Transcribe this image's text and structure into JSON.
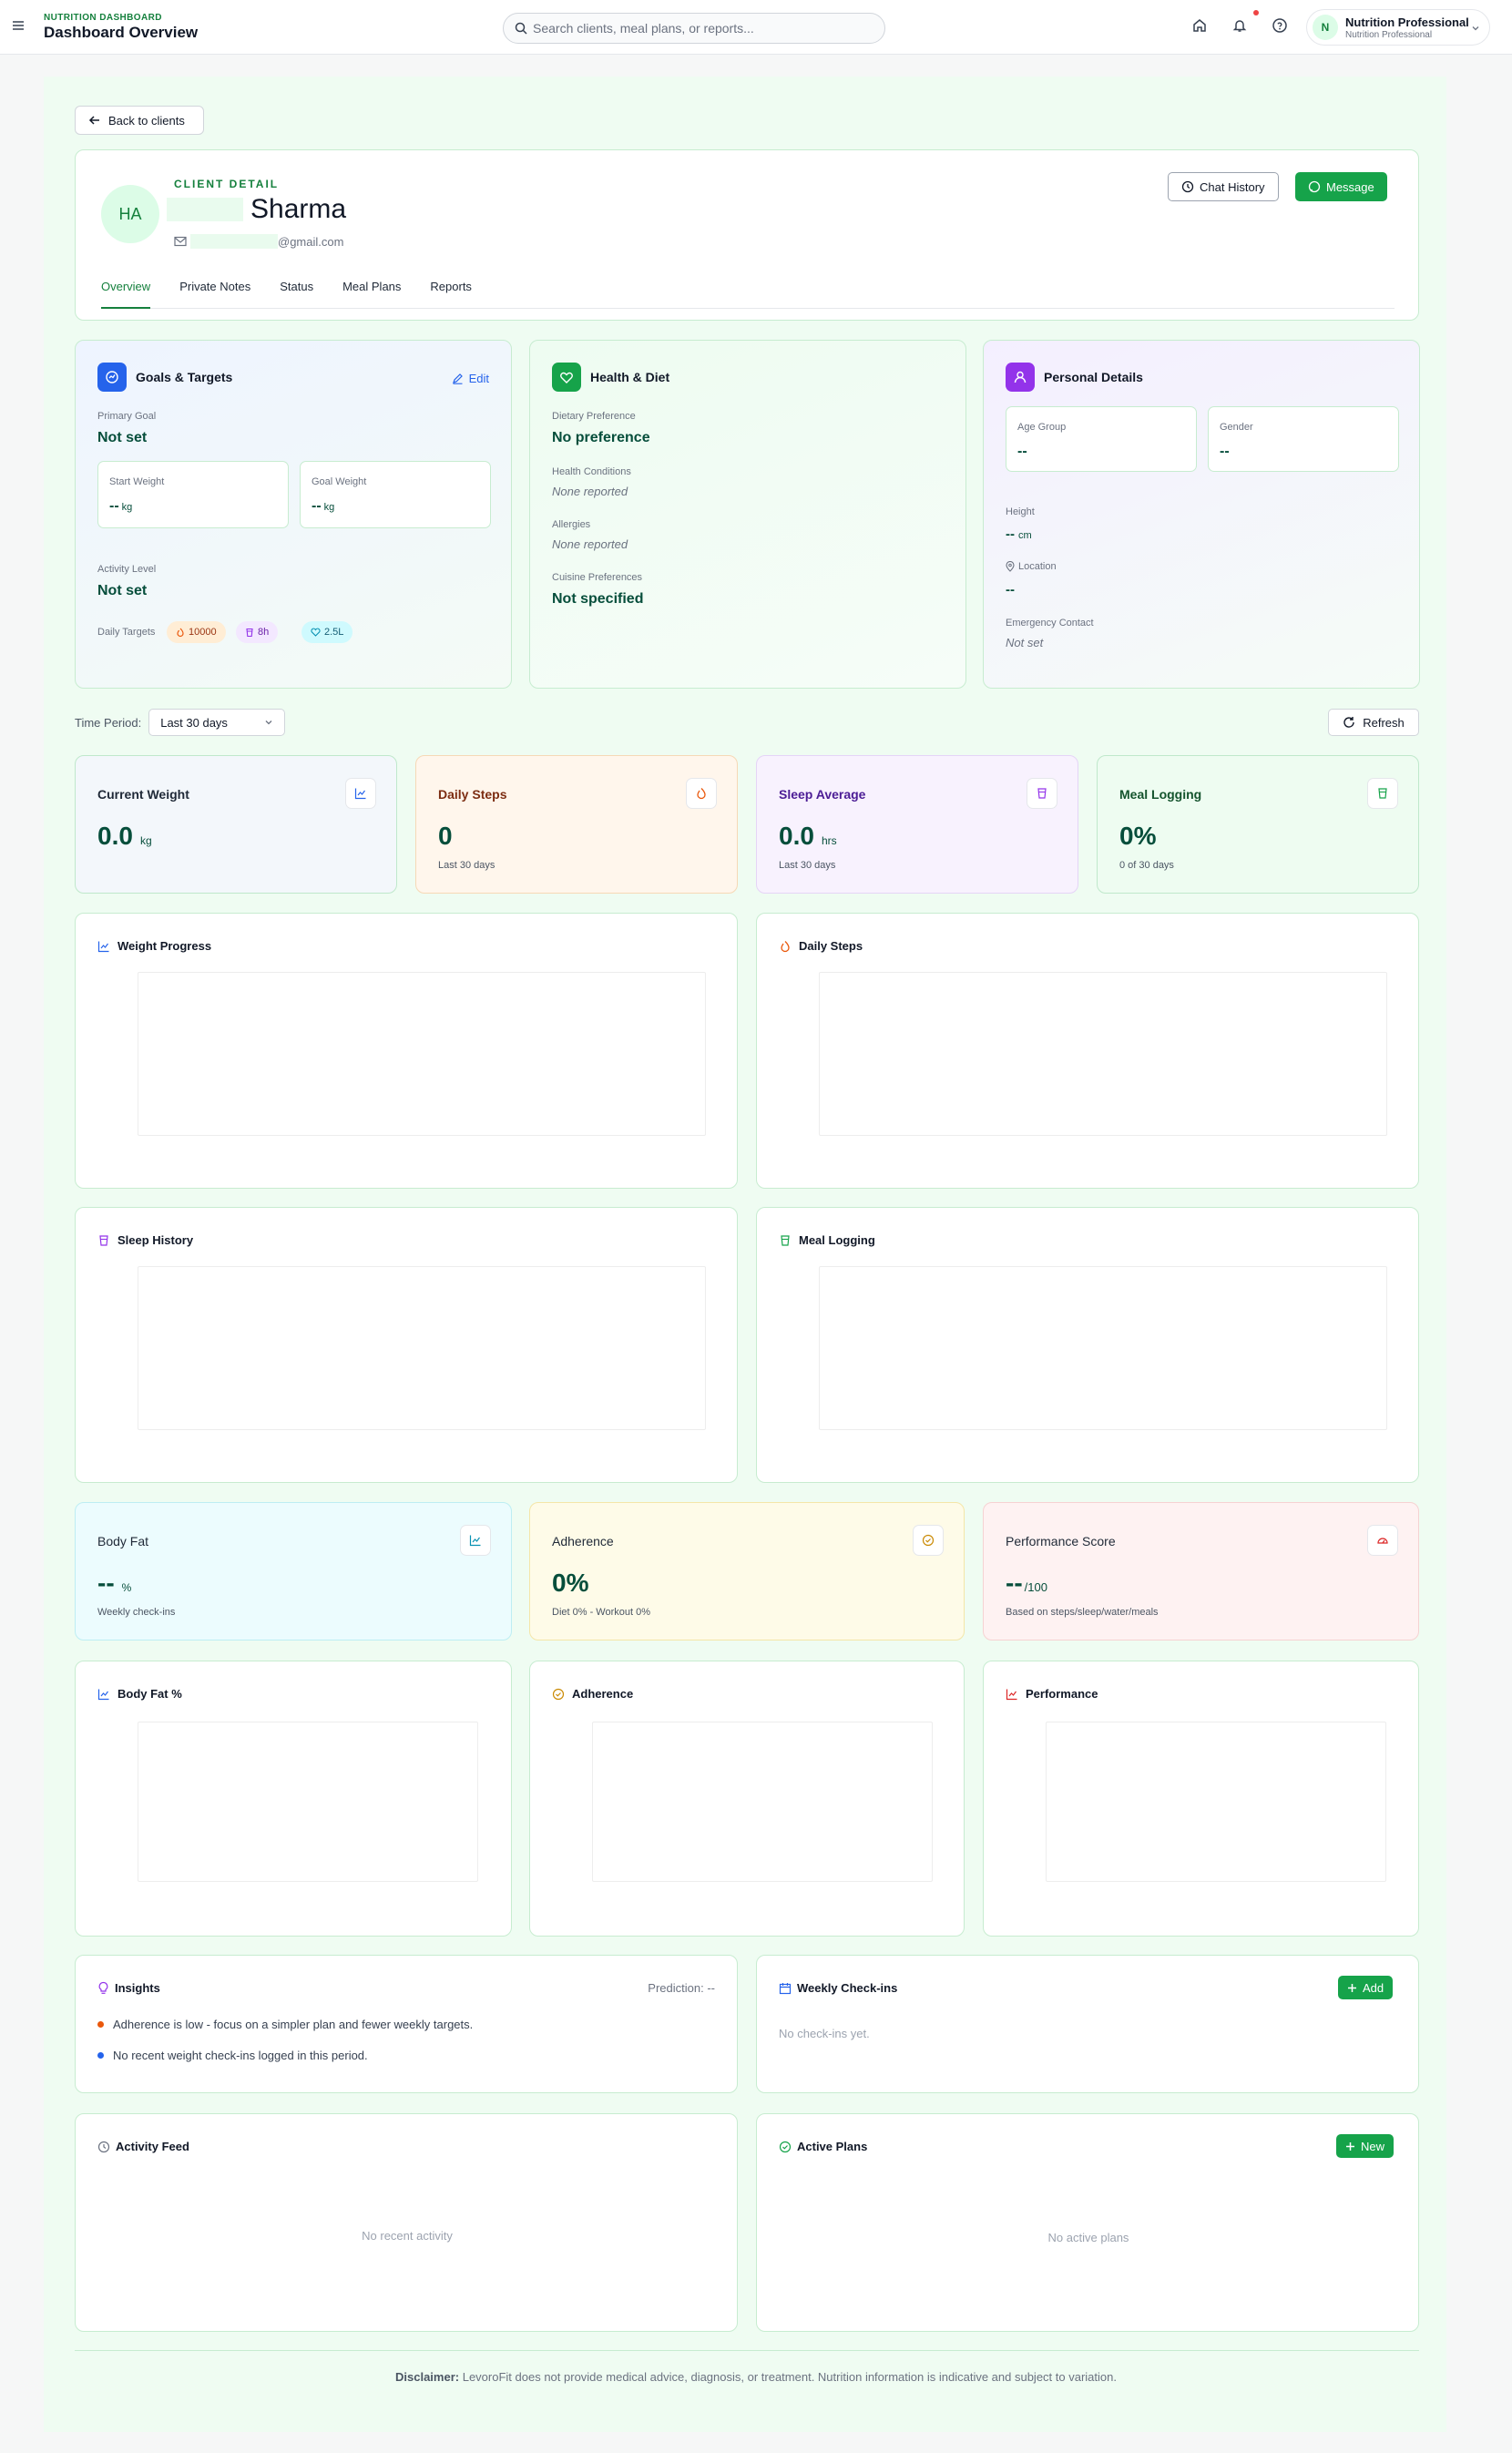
{
  "topbar": {
    "brand_sup": "NUTRITION DASHBOARD",
    "brand_title": "Dashboard Overview",
    "search_placeholder": "Search clients, meal plans, or reports...",
    "profile_initial": "N",
    "profile_name": "Nutrition Professional",
    "profile_role": "Nutrition Professional"
  },
  "back_label": "Back to clients",
  "client": {
    "sup": "CLIENT DETAIL",
    "initials": "HA",
    "last_name": "Sharma",
    "email_domain": "@gmail.com",
    "chat_history_label": "Chat History",
    "message_label": "Message",
    "tabs": [
      "Overview",
      "Private Notes",
      "Status",
      "Meal Plans",
      "Reports"
    ]
  },
  "goals": {
    "title": "Goals & Targets",
    "edit_label": "Edit",
    "primary_goal_label": "Primary Goal",
    "primary_goal_value": "Not set",
    "start_weight_label": "Start Weight",
    "start_weight_value": "--",
    "goal_weight_label": "Goal Weight",
    "goal_weight_value": "--",
    "weight_unit": "kg",
    "activity_label": "Activity Level",
    "activity_value": "Not set",
    "daily_targets_label": "Daily Targets",
    "steps_target": "10000",
    "sleep_target": "8h",
    "water_target": "2.5L"
  },
  "health": {
    "title": "Health & Diet",
    "dietary_label": "Dietary Preference",
    "dietary_value": "No preference",
    "conditions_label": "Health Conditions",
    "conditions_value": "None reported",
    "allergies_label": "Allergies",
    "allergies_value": "None reported",
    "cuisine_label": "Cuisine Preferences",
    "cuisine_value": "Not specified"
  },
  "personal": {
    "title": "Personal Details",
    "age_label": "Age Group",
    "age_value": "--",
    "gender_label": "Gender",
    "gender_value": "--",
    "height_label": "Height",
    "height_value": "--",
    "height_unit": "cm",
    "location_label": "Location",
    "location_value": "--",
    "emergency_label": "Emergency Contact",
    "emergency_value": "Not set"
  },
  "time_period": {
    "label": "Time Period:",
    "selected": "Last 30 days",
    "refresh_label": "Refresh"
  },
  "stats": {
    "weight": {
      "title": "Current Weight",
      "value": "0.0",
      "unit": "kg"
    },
    "steps": {
      "title": "Daily Steps",
      "value": "0",
      "sub": "Last 30 days"
    },
    "sleep": {
      "title": "Sleep Average",
      "value": "0.0",
      "unit": "hrs",
      "sub": "Last 30 days"
    },
    "meal": {
      "title": "Meal Logging",
      "value": "0%",
      "sub": "0 of 30 days"
    },
    "bodyfat": {
      "title": "Body Fat",
      "value": "--",
      "unit": "%",
      "sub": "Weekly check-ins"
    },
    "adherence": {
      "title": "Adherence",
      "value": "0%",
      "sub": "Diet 0% - Workout 0%"
    },
    "performance": {
      "title": "Performance Score",
      "value": "--",
      "unit": "/100",
      "sub": "Based on steps/sleep/water/meals"
    }
  },
  "charts": {
    "weight_progress": "Weight Progress",
    "daily_steps": "Daily Steps",
    "sleep_history": "Sleep History",
    "meal_logging": "Meal Logging",
    "body_fat": "Body Fat %",
    "adherence": "Adherence",
    "performance": "Performance"
  },
  "insights": {
    "title": "Insights",
    "prediction": "Prediction: --",
    "items": [
      "Adherence is low - focus on a simpler plan and fewer weekly targets.",
      "No recent weight check-ins logged in this period."
    ]
  },
  "checkins": {
    "title": "Weekly Check-ins",
    "add_label": "Add",
    "empty": "No check-ins yet."
  },
  "activity": {
    "title": "Activity Feed",
    "empty": "No recent activity"
  },
  "plans": {
    "title": "Active Plans",
    "new_label": "New",
    "empty": "No active plans"
  },
  "disclaimer": {
    "prefix": "Disclaimer:",
    "text": "LevoroFit does not provide medical advice, diagnosis, or treatment. Nutrition information is indicative and subject to variation."
  },
  "colors": {
    "brand_green": "#16a34a",
    "dark_green": "#064e3b",
    "page_tint": "#effcf2"
  }
}
